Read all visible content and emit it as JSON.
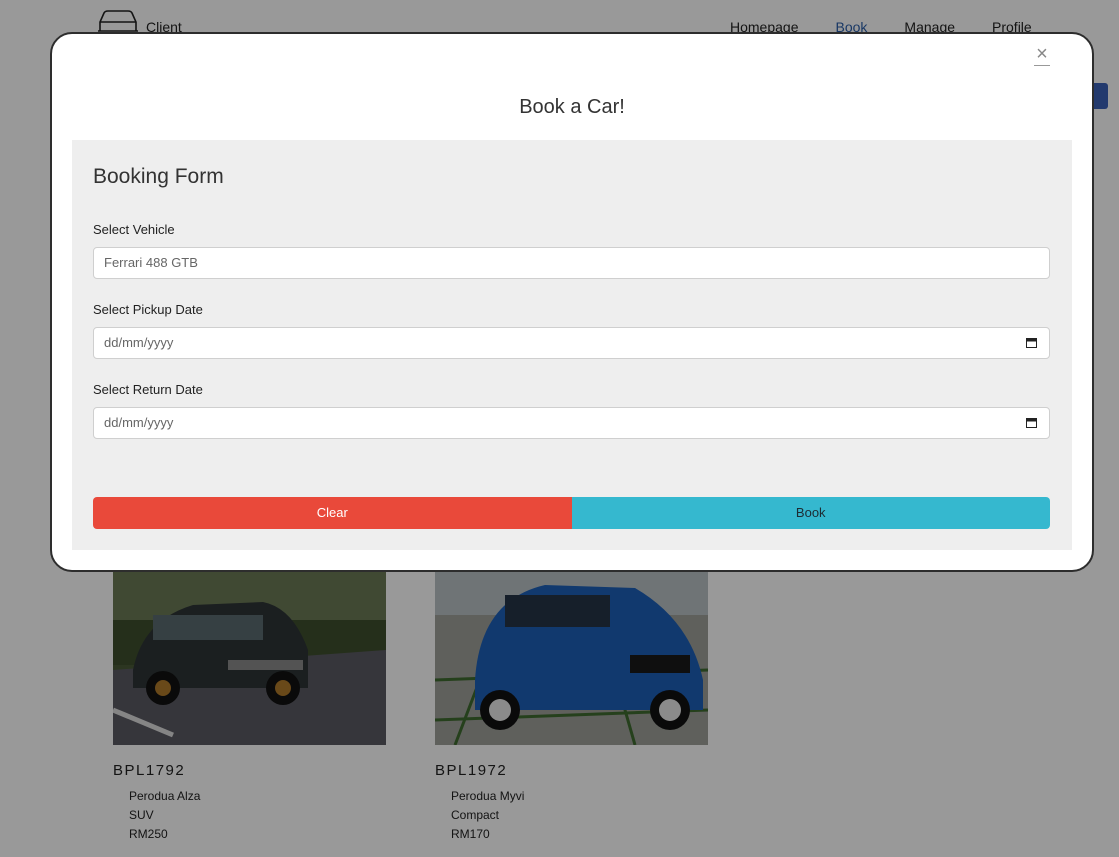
{
  "nav": {
    "brand": "Client",
    "links": [
      "Homepage",
      "Book",
      "Manage",
      "Profile"
    ]
  },
  "cards": [
    {
      "id": "BPL1792",
      "model": "Perodua Alza",
      "type": "SUV",
      "price": "RM250"
    },
    {
      "id": "BPL1972",
      "model": "Perodua Myvi",
      "type": "Compact",
      "price": "RM170"
    }
  ],
  "modal": {
    "close": "×",
    "title": "Book a Car!",
    "form_heading": "Booking Form",
    "vehicle_label": "Select Vehicle",
    "vehicle_value": "Ferrari 488 GTB",
    "pickup_label": "Select Pickup Date",
    "pickup_placeholder": "dd/mm/yyyy",
    "return_label": "Select Return Date",
    "return_placeholder": "dd/mm/yyyy",
    "clear_label": "Clear",
    "book_label": "Book"
  },
  "colors": {
    "clear": "#e9493a",
    "book": "#35b8cf",
    "accent": "#2a5ea8"
  },
  "icons": [
    "car-icon",
    "close-icon",
    "calendar-icon"
  ]
}
